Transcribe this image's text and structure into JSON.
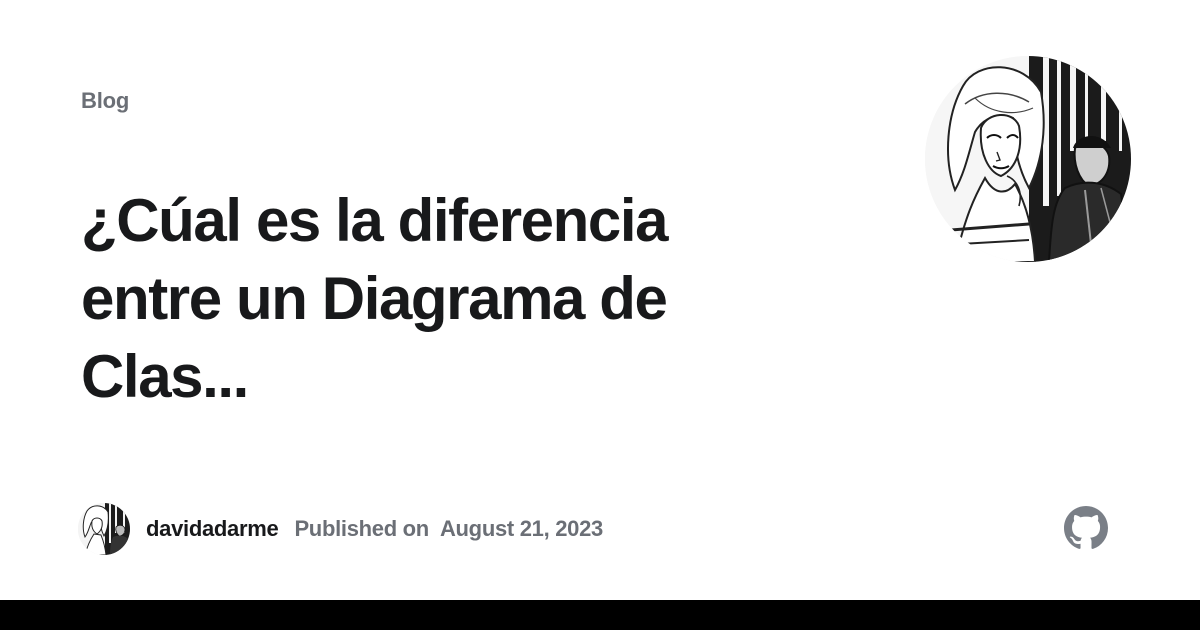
{
  "card": {
    "eyebrow": "Blog",
    "title": "¿Cúal es la diferencia entre un Diagrama de Clas...",
    "author": "davidadarme",
    "published_label": "Published on",
    "published_date": "August 21, 2023"
  },
  "colors": {
    "background": "#ffffff",
    "title_text": "#18191b",
    "muted_text": "#6b6f76",
    "github_icon": "#7a7f87",
    "bottom_bar": "#000000"
  },
  "icons": {
    "hero_image": "comic-illustration-avatar",
    "author_image": "author-avatar",
    "github": "github-icon"
  }
}
